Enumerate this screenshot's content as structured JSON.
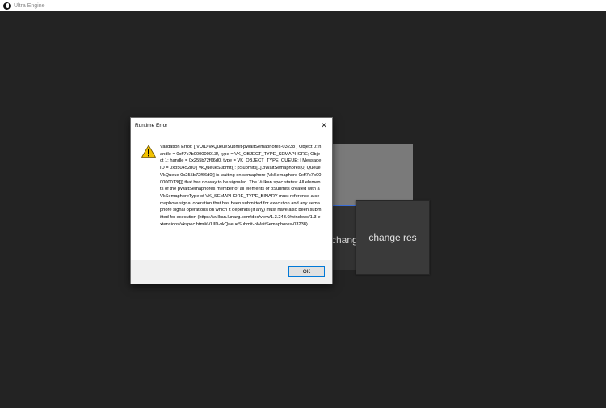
{
  "window": {
    "title": "Ultra Engine",
    "icon": "ultra-engine-logo-icon"
  },
  "scene": {
    "panel_label": "change res",
    "button_label": "change res",
    "colors": {
      "background": "#232323",
      "grey_panel": "#7a7a7a",
      "focus_outline": "#3a6ed8"
    }
  },
  "dialog": {
    "title": "Runtime Error",
    "close_icon": "close-icon",
    "warning_icon": "warning-icon",
    "message": "Validation Error: [ VUID-vkQueueSubmit-pWaitSemaphores-03238 ] Object 0: handle = 0xff7c7b000000013f, type = VK_OBJECT_TYPE_SEMAPHORE; Object 1: handle = 0x255b72f66d0, type = VK_OBJECT_TYPE_QUEUE; | MessageID = 0xb50452b0 | vkQueueSubmit(): pSubmits[1].pWaitSemaphores[0] Queue VkQueue 0x255b72f66d0[] is waiting on semaphore (VkSemaphore 0xff7c7b000000013f[]) that has no way to be signaled. The Vulkan spec states: All elements of the pWaitSemaphores member of all elements of pSubmits created with a VkSemaphoreType of VK_SEMAPHORE_TYPE_BINARY must reference a semaphore signal operation that has been submitted for execution and any semaphore signal operations on which it depends (if any) must have also been submitted for execution (https://vulkan.lunarg.com/doc/view/1.3.243.0/windows/1.3-extensions/vkspec.html#VUID-vkQueueSubmit-pWaitSemaphores-03238)",
    "ok_label": "OK"
  }
}
